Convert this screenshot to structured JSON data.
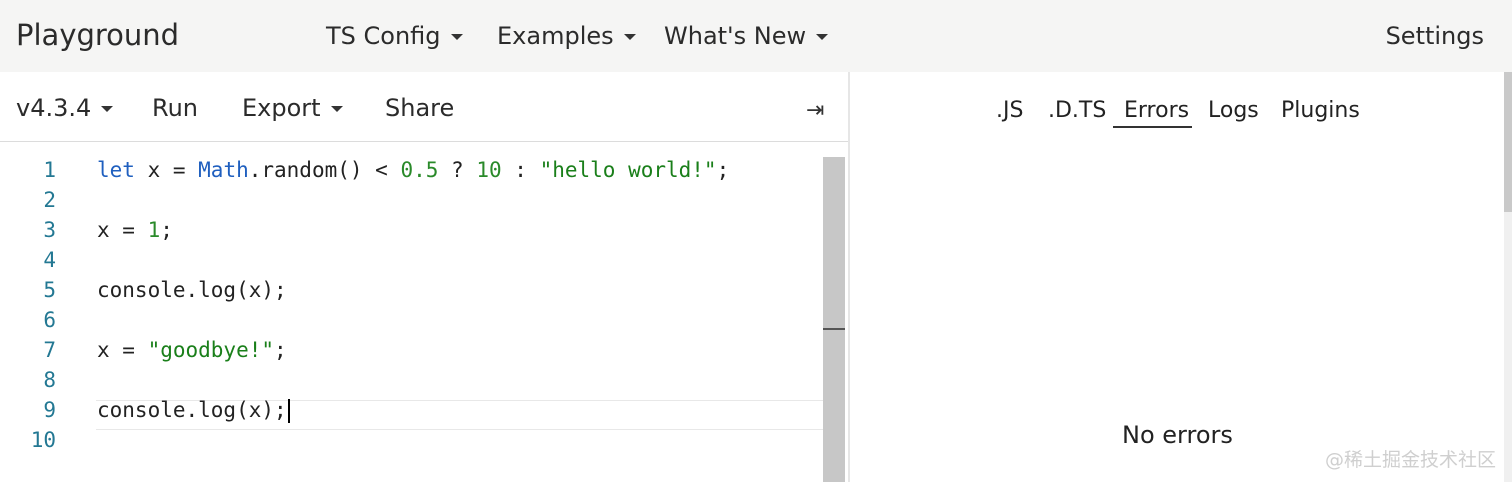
{
  "nav": {
    "brand": "Playground",
    "items": [
      "TS Config",
      "Examples",
      "What's New"
    ],
    "settings": "Settings"
  },
  "toolbar": {
    "version": "v4.3.4",
    "run": "Run",
    "export": "Export",
    "share": "Share",
    "collapse_icon": "⇥"
  },
  "editor": {
    "line_numbers": [
      "1",
      "2",
      "3",
      "4",
      "5",
      "6",
      "7",
      "8",
      "9",
      "10"
    ]
  },
  "code": {
    "l1": {
      "kw": "let",
      "a": " x = ",
      "cls": "Math",
      "b": ".random() < ",
      "n1": "0.5",
      "c": " ? ",
      "n2": "10",
      "d": " : ",
      "s": "\"hello world!\"",
      "e": ";"
    },
    "l3": {
      "a": "x = ",
      "n": "1",
      "b": ";"
    },
    "l5": "console.log(x);",
    "l7": {
      "a": "x = ",
      "s": "\"goodbye!\"",
      "b": ";"
    },
    "l9": "console.log(x);"
  },
  "right_panel": {
    "tabs": [
      ".JS",
      ".D.TS",
      "Errors",
      "Logs",
      "Plugins"
    ],
    "active_tab": "Errors",
    "message": "No errors"
  },
  "watermark": "@稀土掘金技术社区",
  "colors": {
    "keyword": "#1f5fbf",
    "number": "#2a8a2a",
    "string": "#1a7f1a",
    "line_number": "#237893"
  }
}
